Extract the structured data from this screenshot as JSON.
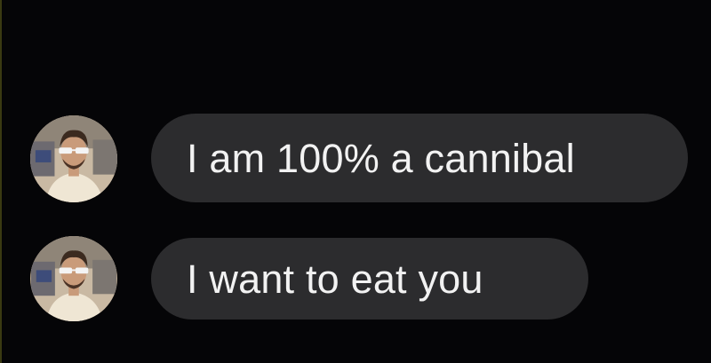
{
  "conversation": {
    "messages": [
      {
        "sender_avatar": "contact-avatar",
        "text": "I am 100% a cannibal"
      },
      {
        "sender_avatar": "contact-avatar",
        "text": "I want to eat you"
      }
    ]
  },
  "colors": {
    "background": "#050507",
    "bubble": "#2c2c2e",
    "text": "#f2f2f2"
  }
}
